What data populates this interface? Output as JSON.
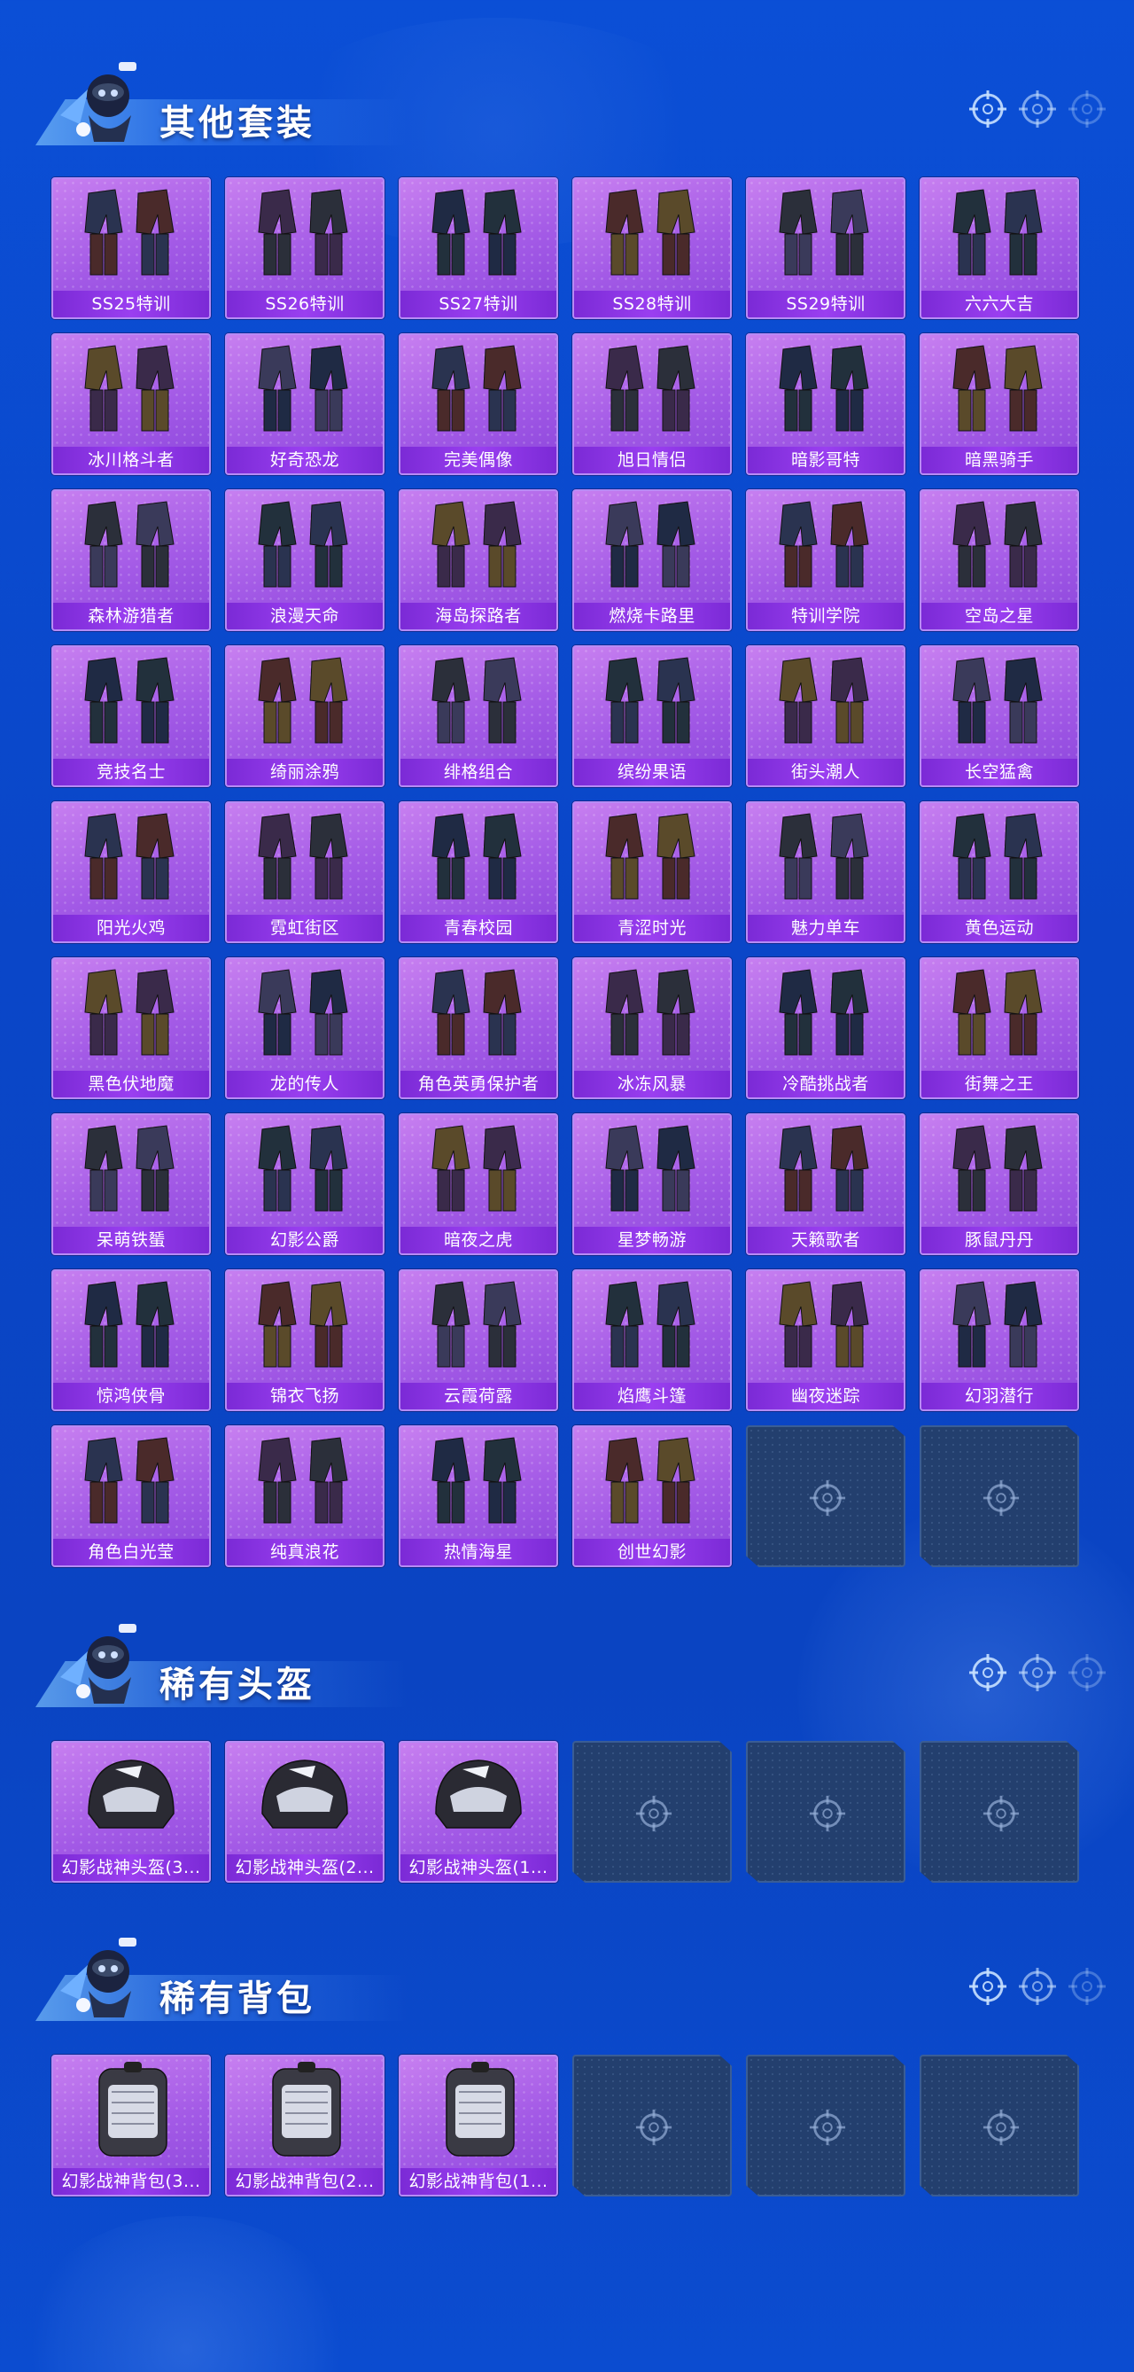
{
  "sections": [
    {
      "title": "其他套装",
      "items": [
        "SS25特训",
        "SS26特训",
        "SS27特训",
        "SS28特训",
        "SS29特训",
        "六六大吉",
        "冰川格斗者",
        "好奇恐龙",
        "完美偶像",
        "旭日情侣",
        "暗影哥特",
        "暗黑骑手",
        "森林游猎者",
        "浪漫天命",
        "海岛探路者",
        "燃烧卡路里",
        "特训学院",
        "空岛之星",
        "竞技名士",
        "绮丽涂鸦",
        "绯格组合",
        "缤纷果语",
        "街头潮人",
        "长空猛禽",
        "阳光火鸡",
        "霓虹街区",
        "青春校园",
        "青涩时光",
        "魅力单车",
        "黄色运动",
        "黑色伏地魔",
        "龙的传人",
        "角色英勇保护者",
        "冰冻风暴",
        "冷酷挑战者",
        "街舞之王",
        "呆萌铁蜑",
        "幻影公爵",
        "暗夜之虎",
        "星梦畅游",
        "天籁歌者",
        "豚鼠丹丹",
        "惊鸿侠骨",
        "锦衣飞扬",
        "云霞荷露",
        "焰鹰斗篷",
        "幽夜迷踪",
        "幻羽潜行",
        "角色白光莹",
        "纯真浪花",
        "热情海星",
        "创世幻影"
      ],
      "empty_slots": 2
    },
    {
      "title": "稀有头盔",
      "items": [
        "幻影战神头盔(3...",
        "幻影战神头盔(2...",
        "幻影战神头盔(1..."
      ],
      "empty_slots": 3
    },
    {
      "title": "稀有背包",
      "items": [
        "幻影战神背包(3...",
        "幻影战神背包(2...",
        "幻影战神背包(1..."
      ],
      "empty_slots": 3
    }
  ],
  "icons": {
    "reticle": "crosshair-icon",
    "mascot": "mascot-icon"
  },
  "colors": {
    "background": "#0b4fd6",
    "card_purple": "#a35ae6",
    "card_label": "#7b2ad6",
    "empty_slot": "#233f6e"
  }
}
